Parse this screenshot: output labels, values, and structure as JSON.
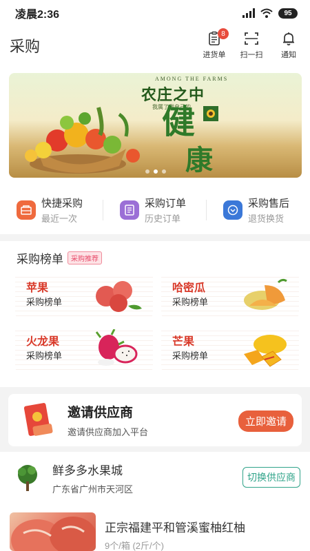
{
  "status_bar": {
    "time": "凌晨2:36",
    "battery": "95"
  },
  "header": {
    "title": "采购",
    "actions": [
      {
        "label": "进货单",
        "icon": "clipboard-icon",
        "badge": "8"
      },
      {
        "label": "扫一扫",
        "icon": "scan-icon"
      },
      {
        "label": "通知",
        "icon": "bell-icon"
      }
    ]
  },
  "banner": {
    "eng_text": "AMONG THE FARMS",
    "title": "农庄之中",
    "subtitle": "我属了我自己的",
    "big_char_1": "健",
    "big_char_2": "康",
    "active_slide": 1,
    "slide_count": 3
  },
  "quick": [
    {
      "title": "快捷采购",
      "sub": "最近一次",
      "icon": "quick-purchase-icon",
      "color": "#ef6a3e"
    },
    {
      "title": "采购订单",
      "sub": "历史订单",
      "icon": "order-icon",
      "color": "#9b6fd6"
    },
    {
      "title": "采购售后",
      "sub": "退货换货",
      "icon": "after-sales-icon",
      "color": "#3b78d8"
    }
  ],
  "rank": {
    "title": "采购榜单",
    "tag": "采购推荐",
    "items": [
      {
        "name": "苹果",
        "sub": "采购榜单",
        "icon": "apple-icon"
      },
      {
        "name": "哈密瓜",
        "sub": "采购榜单",
        "icon": "melon-icon"
      },
      {
        "name": "火龙果",
        "sub": "采购榜单",
        "icon": "dragonfruit-icon"
      },
      {
        "name": "芒果",
        "sub": "采购榜单",
        "icon": "mango-icon"
      }
    ]
  },
  "invite": {
    "title": "邀请供应商",
    "sub": "邀请供应商加入平台",
    "button": "立即邀请"
  },
  "supplier": {
    "name": "鲜多多水果城",
    "address": "广东省广州市天河区",
    "button": "切换供应商"
  },
  "product": {
    "name": "正宗福建平和管溪蜜柚红柚",
    "spec": "9个/箱 (2斤/个)"
  }
}
